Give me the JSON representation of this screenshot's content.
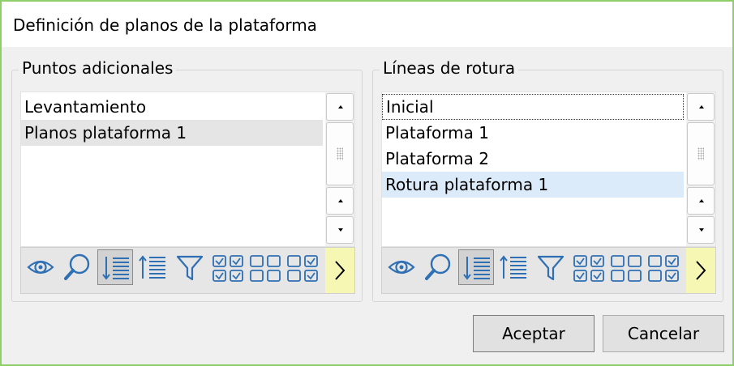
{
  "window": {
    "title": "Definición de planos de la plataforma"
  },
  "left_group": {
    "legend": "Puntos adicionales",
    "items": [
      {
        "label": "Levantamiento"
      },
      {
        "label": "Planos plataforma 1"
      }
    ]
  },
  "right_group": {
    "legend": "Líneas de rotura",
    "items": [
      {
        "label": "Inicial"
      },
      {
        "label": "Plataforma 1"
      },
      {
        "label": "Plataforma 2"
      },
      {
        "label": "Rotura plataforma 1"
      }
    ]
  },
  "toolbar_icons": [
    "eye-icon",
    "search-icon",
    "sort-descending-icon",
    "sort-ascending-icon",
    "filter-icon",
    "check-all-icon",
    "uncheck-all-icon",
    "invert-check-icon",
    "chevron-right-icon"
  ],
  "colors": {
    "accent_border": "#8fcf6a",
    "icon_blue": "#2f6fb4",
    "next_button": "#f7f7b4",
    "selected_blue": "#dcebfa"
  },
  "buttons": {
    "accept": "Aceptar",
    "cancel": "Cancelar"
  }
}
